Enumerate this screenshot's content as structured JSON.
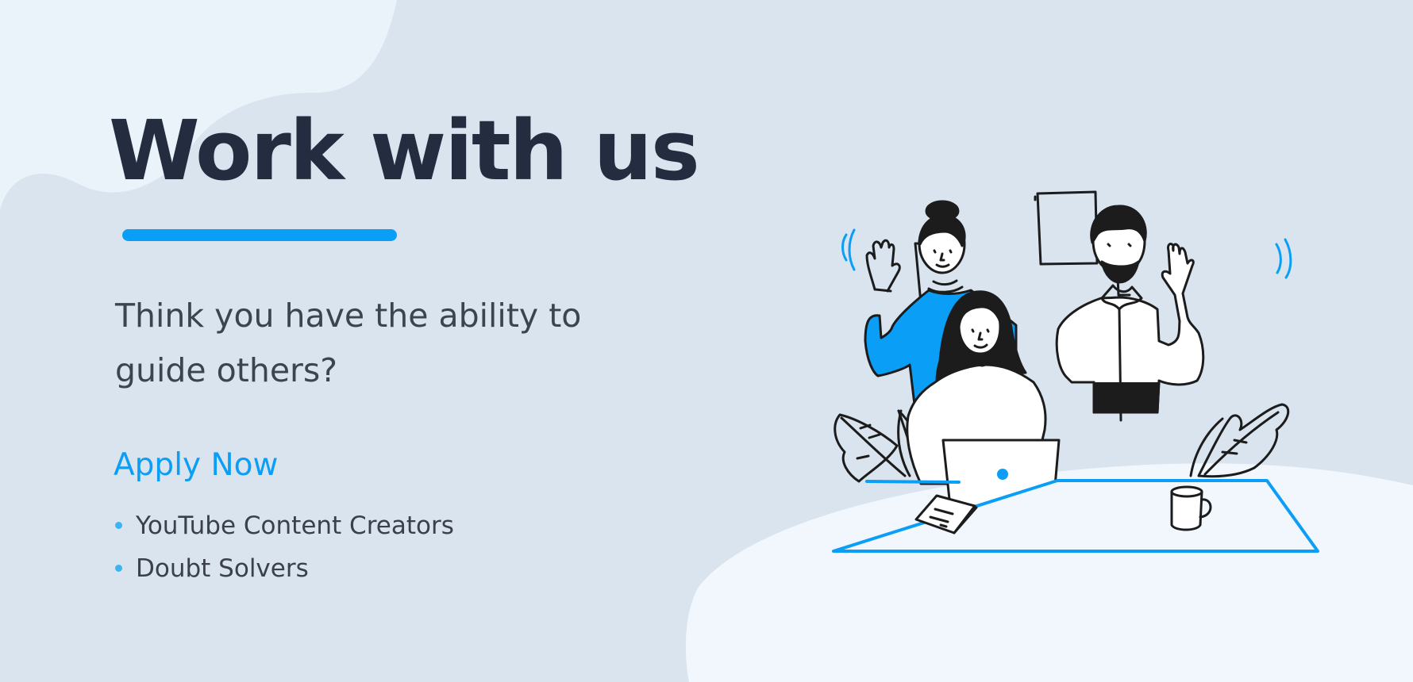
{
  "hero": {
    "title": "Work with us",
    "subtitle": "Think you have the ability to guide others?",
    "cta_label": "Apply Now",
    "roles": [
      "YouTube Content Creators",
      "Doubt Solvers"
    ]
  },
  "colors": {
    "accent": "#0b9ef6",
    "title": "#242d40",
    "background": "#d9e4ef",
    "light_blob": "#eef4fa"
  },
  "illustration": {
    "icons": [
      "team-people-icon",
      "laptop-icon",
      "coffee-mug-icon",
      "notepad-icon",
      "plant-leaf-icon",
      "picture-frame-icon"
    ]
  }
}
